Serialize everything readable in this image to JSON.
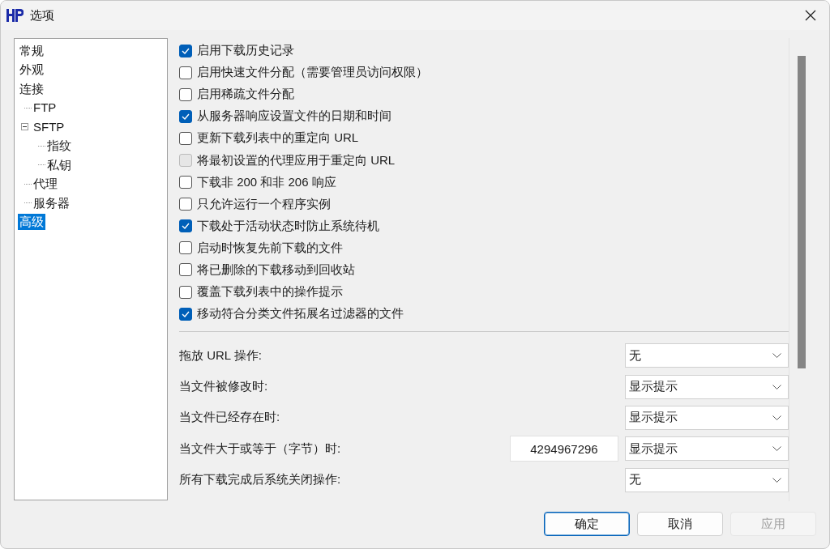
{
  "window": {
    "title": "选项"
  },
  "tree": [
    {
      "label": "常规",
      "selected": false
    },
    {
      "label": "外观",
      "selected": false
    },
    {
      "label": "连接",
      "selected": false,
      "children": [
        {
          "label": "FTP",
          "selected": false
        },
        {
          "label": "SFTP",
          "selected": false,
          "expanded": true,
          "children": [
            {
              "label": "指纹",
              "selected": false
            },
            {
              "label": "私钥",
              "selected": false
            }
          ]
        },
        {
          "label": "代理",
          "selected": false
        },
        {
          "label": "服务器",
          "selected": false
        }
      ]
    },
    {
      "label": "高级",
      "selected": true
    }
  ],
  "options": [
    {
      "label": "启用下载历史记录",
      "checked": true,
      "disabled": false
    },
    {
      "label": "启用快速文件分配（需要管理员访问权限）",
      "checked": false,
      "disabled": false
    },
    {
      "label": "启用稀疏文件分配",
      "checked": false,
      "disabled": false
    },
    {
      "label": "从服务器响应设置文件的日期和时间",
      "checked": true,
      "disabled": false
    },
    {
      "label": "更新下载列表中的重定向 URL",
      "checked": false,
      "disabled": false
    },
    {
      "label": "将最初设置的代理应用于重定向 URL",
      "checked": false,
      "disabled": true
    },
    {
      "label": "下载非 200 和非 206 响应",
      "checked": false,
      "disabled": false
    },
    {
      "label": "只允许运行一个程序实例",
      "checked": false,
      "disabled": false
    },
    {
      "label": "下载处于活动状态时防止系统待机",
      "checked": true,
      "disabled": false
    },
    {
      "label": "启动时恢复先前下载的文件",
      "checked": false,
      "disabled": false
    },
    {
      "label": "将已删除的下载移动到回收站",
      "checked": false,
      "disabled": false
    },
    {
      "label": "覆盖下载列表中的操作提示",
      "checked": false,
      "disabled": false
    },
    {
      "label": "移动符合分类文件拓展名过滤器的文件",
      "checked": true,
      "disabled": false
    }
  ],
  "settings": [
    {
      "label": "拖放 URL 操作:",
      "value": "无"
    },
    {
      "label": "当文件被修改时:",
      "value": "显示提示"
    },
    {
      "label": "当文件已经存在时:",
      "value": "显示提示"
    },
    {
      "label": "当文件大于或等于（字节）时:",
      "input": "4294967296",
      "value": "显示提示"
    },
    {
      "label": "所有下载完成后系统关闭操作:",
      "value": "无"
    }
  ],
  "buttons": [
    {
      "label": "确定",
      "disabled": false,
      "default": true
    },
    {
      "label": "取消",
      "disabled": false,
      "default": false
    },
    {
      "label": "应用",
      "disabled": true,
      "default": false
    }
  ]
}
